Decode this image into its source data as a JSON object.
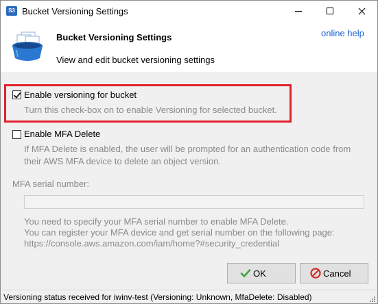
{
  "window": {
    "title": "Bucket Versioning Settings",
    "app_icon_text": "S3"
  },
  "header": {
    "title": "Bucket Versioning Settings",
    "subtitle": "View and edit bucket versioning settings",
    "help_link": "online help"
  },
  "versioning": {
    "label": "Enable versioning for bucket",
    "checked": true,
    "description": "Turn this check-box on to enable Versioning for selected bucket."
  },
  "mfa_delete": {
    "label": "Enable MFA Delete",
    "checked": false,
    "description_line1": "If MFA Delete is enabled, the user will be prompted for an authentication code from",
    "description_line2": "their AWS MFA device to delete an object version."
  },
  "mfa_serial": {
    "label": "MFA serial number:",
    "value": "",
    "note_line1": "You need to specify your MFA serial number to enable MFA Delete.",
    "note_line2": "You can register your MFA device and get serial number on the following page:",
    "note_line3": "https://console.aws.amazon.com/iam/home?#security_credential"
  },
  "buttons": {
    "ok_label": "OK",
    "cancel_label": "Cancel"
  },
  "status_bar": {
    "text": "Versioning status received for iwinv-test (Versioning: Unknown, MfaDelete: Disabled)"
  },
  "colors": {
    "highlight": "#e0202a",
    "link": "#1a5fd0",
    "disabled_text": "#8a8a8a"
  }
}
